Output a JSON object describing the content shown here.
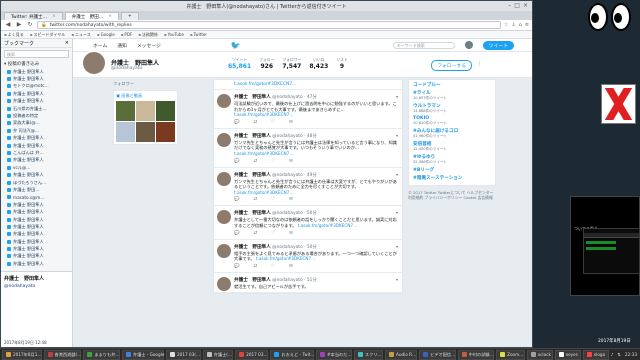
{
  "window": {
    "title": "弁護士　野田隼人(@nodahayato)さん | Twitterから返信付きツイート"
  },
  "tabs": [
    {
      "label": "Twitter: 弁護士…",
      "active": false
    },
    {
      "label": "弁護士　野田…",
      "active": true
    }
  ],
  "nav": {
    "url": "twitter.com/nodahayato/with_replies"
  },
  "bookmarks": [
    "よく見る",
    "スピードダイヤル",
    "ニュース",
    "Google",
    "PDF",
    "法務関係",
    "YouTube",
    "Twitter"
  ],
  "sidebar": {
    "title": "ブックマーク",
    "search_placeholder": "検索",
    "folder": "投稿の書き込み",
    "items": [
      "弁護士 野田隼人",
      "弁護士 野田隼人",
      "モトクロ@motc…",
      "弁護士 野田隼人",
      "弁護士 野田隼人",
      "石川県の弁護士…",
      "投稿者の特定",
      "家族大事(@…",
      "弁 司法?(@…",
      "弁護士 野田隼人",
      "弁護士 野田隼人",
      "こんばんは 弁…",
      "弁護士 野田隼人",
      "vcル@…",
      "弁護士 野田隼人",
      "ほづたろうさん…",
      "弁護士 野田…",
      "masato.s@m…",
      "弁護士 野田隼人",
      "弁護士 野田隼人",
      "弁護士 野田隼人",
      "弁護士 野田隼人",
      "弁護士 野田隼人",
      "弁護士 野田隼人",
      "弁護士 野田隼人",
      "弁護士 野田隼人",
      "弁護士 野田隼人"
    ],
    "footer_name": "弁護士　野田隼人",
    "footer_handle": "@nodahayato",
    "footer_date": "2017年8月19日 12:48"
  },
  "twitter": {
    "nav": [
      "ホーム",
      "通知",
      "メッセージ"
    ],
    "search_placeholder": "キーワード検索",
    "tweet_button": "ツイート",
    "profile_name": "弁護士　野田隼人",
    "profile_handle": "@nodahayato",
    "stats": [
      {
        "label": "ツイート",
        "value": "65,861",
        "active": true
      },
      {
        "label": "フォロー",
        "value": "926",
        "active": false
      },
      {
        "label": "フォロワー",
        "value": "7,547",
        "active": false
      },
      {
        "label": "いいね",
        "value": "8,423",
        "active": false
      },
      {
        "label": "リスト",
        "value": "9",
        "active": false
      }
    ],
    "follow_button": "フォローする",
    "followers_note": "フォロワー",
    "media_header": "画像と動画",
    "top_link": "t.asok.fm/goto/#3DKECN7…",
    "tweets": [
      {
        "name": "弁護士　野田隼人",
        "meta": "@nodahayato · 47分",
        "text": "司法試験が近いので、最後の仕上げに過去問を中心に勉強するのがいいと思います。これからの1ヶ月がとても大事です。最後まであきらめずに…",
        "link": "t.asok.fm/goto/#3DKECN7…"
      },
      {
        "name": "弁護士　野田隼人",
        "meta": "@nodahayato · 48分",
        "text": "ガンマ先生とちゃんと先生が言うには弁護士は法律を知っていると言う事になり、知識だけでなく実務の感覚が大事です。いつもそういう事でいいのか…",
        "link": "t.asok.fm/goto/#3DKECN7…"
      },
      {
        "name": "弁護士　野田隼人",
        "meta": "@nodahayato · 49分",
        "text": "ガンマ先生とちゃんと先生が言うには弁護士の仕事は大変ですが、とてもやりがいがあるということです。依頼者のために全力を尽くすことが大切です。",
        "link": "t.asok.fm/goto/#3DKECN7…"
      },
      {
        "name": "弁護士　野田隼人",
        "meta": "@nodahayato · 50分",
        "text": "弁護士として一番大切なのは依頼者の話をしっかり聞くことだと思います。誠実に対応することが信頼につながります。",
        "link": "t.asok.fm/goto/#3DKECN7…"
      },
      {
        "name": "弁護士　野田隼人",
        "meta": "@nodahayato · 50分",
        "text": "相手の主張をよく見てみると矛盾がある場合があります。一つ一つ確認していくことが大事です。",
        "link": "t.asok.fm/goto/#3DKECN7…"
      },
      {
        "name": "弁護士　野田隼人",
        "meta": "@nodahayato · 51分",
        "text": "就活生です。自己アピールが苦手です。",
        "link": ""
      }
    ],
    "trends_title": "おすすめトレンド",
    "trends": [
      {
        "tag": "コードブルー",
        "count": ""
      },
      {
        "tag": "#ライル",
        "count": "10,657件のツイート"
      },
      {
        "tag": "ウルトラマン",
        "count": "14,888件のツイート"
      },
      {
        "tag": "TOKIO",
        "count": "10,610件のツイート"
      },
      {
        "tag": "#みんなに届けるコロ",
        "count": "41,960件のツイート"
      },
      {
        "tag": "安倍首相",
        "count": "12,450件のツイート"
      },
      {
        "tag": "#ゆるゆり",
        "count": "32,386件のツイート"
      },
      {
        "tag": "#Bリーグ",
        "count": ""
      },
      {
        "tag": "#暗黒スーステーション",
        "count": ""
      }
    ],
    "footer": "© 2017 Twitter  Twitterについて  ヘルプセンター  利用規約  プライバシーポリシー  Cookie  広告情報"
  },
  "desktop": {
    "term_text": "ついてる思う",
    "clock_time": "22:33",
    "clock_date": "2017年8月19日"
  },
  "taskbar": {
    "items": [
      {
        "label": "2017年8月1…",
        "color": "#e0a040"
      },
      {
        "label": "香港西遊戯(…",
        "color": "#c04040"
      },
      {
        "label": "ままりも弁…",
        "color": "#40a040"
      },
      {
        "label": "弁護士 - Google",
        "color": "#4080e0"
      },
      {
        "label": "2017 03(…",
        "color": "#e0e0e0"
      },
      {
        "label": "弁護士(…",
        "color": "#c0c0c0"
      },
      {
        "label": "2017 03…",
        "color": "#e04040"
      },
      {
        "label": "おおえど - Twit…",
        "color": "#1da1f2"
      },
      {
        "label": "#本当のだ…",
        "color": "#a040c0"
      },
      {
        "label": "スクリ…",
        "color": "#40c0c0"
      },
      {
        "label": "Audio R…",
        "color": "#c0a040"
      },
      {
        "label": "ビデオ配信…",
        "color": "#4060c0"
      },
      {
        "label": "中村の試験…",
        "color": "#c06040"
      },
      {
        "label": "Zoom…",
        "color": "#e0e040"
      },
      {
        "label": "xclock",
        "color": "#a0a0a0"
      },
      {
        "label": "xeyes",
        "color": "#ffffff"
      },
      {
        "label": "xlogo",
        "color": "#ff4040"
      }
    ],
    "time": "22:33"
  }
}
